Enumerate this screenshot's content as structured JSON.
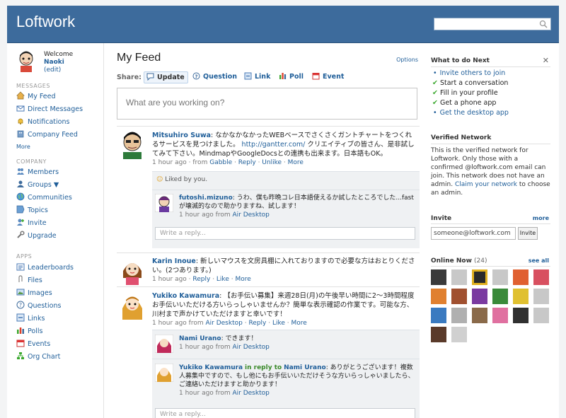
{
  "topbar": {
    "brand": "Loftwork"
  },
  "sidebar": {
    "welcome": "Welcome",
    "user": "Naoki",
    "edit": "(edit)",
    "messages_head": "MESSAGES",
    "messages": [
      "My Feed",
      "Direct Messages",
      "Notifications",
      "Company Feed"
    ],
    "more": "More",
    "company_head": "COMPANY",
    "company": [
      "Members",
      "Groups ▼",
      "Communities",
      "Topics",
      "Invite",
      "Upgrade"
    ],
    "apps_head": "APPS",
    "apps": [
      "Leaderboards",
      "Files",
      "Images",
      "Questions",
      "Links",
      "Polls",
      "Events",
      "Org Chart"
    ]
  },
  "main": {
    "title": "My Feed",
    "options": "Options",
    "share_label": "Share:",
    "share": [
      "Update",
      "Question",
      "Link",
      "Poll",
      "Event"
    ],
    "composer_placeholder": "What are you working on?",
    "posts": [
      {
        "author": "Mitsuhiro Suwa",
        "text_a": "なかなかなかったWEBベースでさくさくガントチャートをつくれるサービスを見つけました。",
        "url": "http://gantter.com/",
        "text_b": "クリエイティブの皆さん、是非試してみて下さい。MindmapやGoogleDocsとの連携も出来ます。日本語もOK。",
        "meta": [
          "1 hour ago",
          "from",
          "Gabble",
          "Reply",
          "Unlike",
          "More"
        ],
        "liked": "Liked by you.",
        "replies": [
          {
            "author": "futoshi.mizuno",
            "text": "うわ、僕も昨晩コレ日本語使えるか試したところでした...fast が壊滅的なので助かりますね、試します！",
            "time": "1 hour ago from",
            "src": "Air Desktop"
          }
        ],
        "write": "Write a reply..."
      },
      {
        "author": "Karin Inoue",
        "text": "新しいマウスを文房具棚に入れておりますので必要な方はおとりください。(2つあります。)",
        "meta": [
          "1 hour ago",
          "Reply",
          "Like",
          "More"
        ]
      },
      {
        "author": "Yukiko Kawamura",
        "text": "【お手伝い募集】来週28日(月)の午後早い時間に2〜3時間程度お手伝いいただける方いらっしゃいませんか？簡単な表示確認の作業です。可能な方、川村まで声かけていただけますと幸いです！",
        "meta": [
          "1 hour ago",
          "from",
          "Air Desktop",
          "Reply",
          "Like",
          "More"
        ],
        "replies": [
          {
            "author": "Nami Urano",
            "text": "できます！",
            "time": "1 hour ago from",
            "src": "Air Desktop"
          },
          {
            "author": "Yukiko Kawamura",
            "inreply": "in reply to",
            "to": "Nami Urano",
            "text": "ありがとうございます！複数人募集中ですので、もし他にもお手伝いいただけそうな方いらっしゃいましたら、ご連絡いただけますと助かります！",
            "time": "1 hour ago from",
            "src": "Air Desktop"
          }
        ],
        "write": "Write a reply..."
      }
    ]
  },
  "right": {
    "todo_head": "What to do Next",
    "todo": [
      "Invite others to join",
      "Start a conversation",
      "Fill in your profile",
      "Get a phone app",
      "Get the desktop app"
    ],
    "verified_head": "Verified Network",
    "verified_text_a": "This is the verified network for Loftwork. Only those with a confirmed @loftwork.com email can join. This network does not have an admin.",
    "verified_link": "Claim your network",
    "verified_text_b": "to choose an admin.",
    "invite_head": "Invite",
    "invite_more": "more",
    "invite_value": "someone@loftwork.com",
    "invite_btn": "Invite",
    "online_head": "Online Now",
    "online_count": "(24)",
    "see_all": "see all"
  },
  "colors": {
    "header": "#3d6b9c",
    "link": "#1f5e99",
    "check": "#3aa82d"
  }
}
